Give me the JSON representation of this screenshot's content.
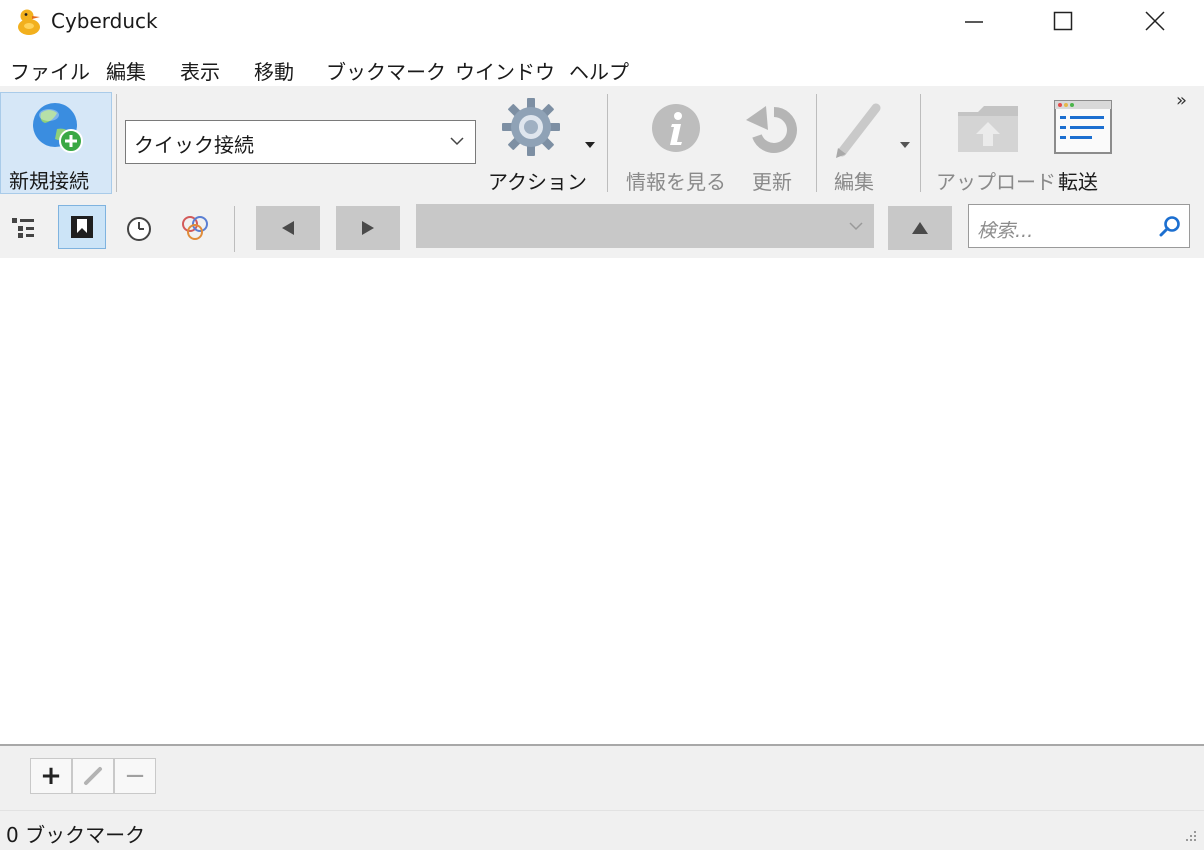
{
  "window": {
    "title": "Cyberduck"
  },
  "menu": [
    "ファイル",
    "編集",
    "表示",
    "移動",
    "ブックマーク",
    "ウインドウ",
    "ヘルプ"
  ],
  "toolbar": {
    "new_connection": "新規接続",
    "quick_connect": "クイック接続",
    "action": "アクション",
    "get_info": "情報を見る",
    "refresh": "更新",
    "edit": "編集",
    "upload": "アップロード",
    "transfers": "転送",
    "overflow": "»"
  },
  "search": {
    "placeholder": "検索..."
  },
  "bottom": {
    "add": "+",
    "remove": "−"
  },
  "status": {
    "text": "0 ブックマーク"
  },
  "icons": {
    "window_minimize": "minimize-icon",
    "window_maximize": "maximize-icon",
    "window_close": "close-icon",
    "outline": "outline-view-icon",
    "bookmarks": "bookmark-icon",
    "history": "history-icon",
    "bonjour": "bonjour-icon",
    "back": "back-icon",
    "forward": "forward-icon",
    "up": "parent-folder-icon",
    "search": "search-icon"
  },
  "colors": {
    "toolbar_bg": "#f1f1f1",
    "selected_bg": "#d6e7f7",
    "accent_blue": "#1c6fd0"
  }
}
